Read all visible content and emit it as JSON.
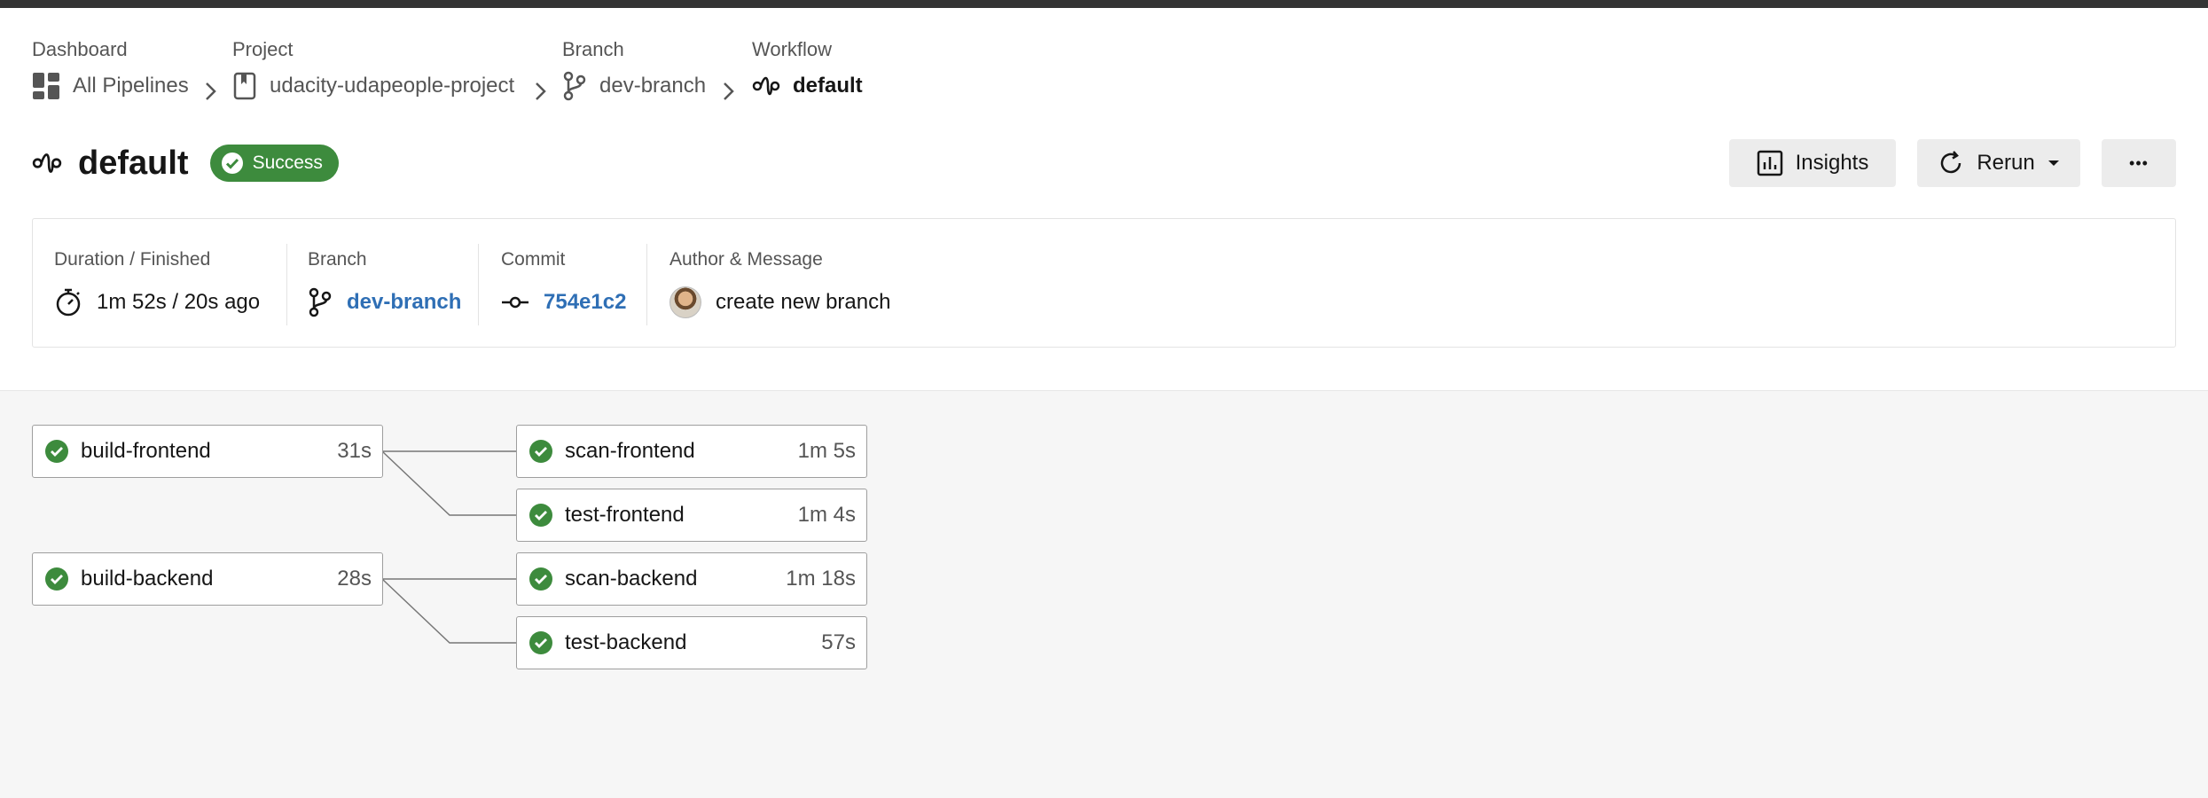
{
  "breadcrumbs": [
    {
      "label": "Dashboard",
      "value": "All Pipelines",
      "icon": "dashboard-grid-icon"
    },
    {
      "label": "Project",
      "value": "udacity-udapeople-project",
      "icon": "bookmark-icon"
    },
    {
      "label": "Branch",
      "value": "dev-branch",
      "icon": "branch-icon"
    },
    {
      "label": "Workflow",
      "value": "default",
      "icon": "workflow-icon"
    }
  ],
  "header": {
    "title": "default",
    "status": "Success",
    "insights_label": "Insights",
    "rerun_label": "Rerun",
    "more_label": "•••"
  },
  "meta": {
    "duration_label": "Duration / Finished",
    "duration_value": "1m 52s / 20s ago",
    "branch_label": "Branch",
    "branch_value": "dev-branch",
    "commit_label": "Commit",
    "commit_value": "754e1c2",
    "author_label": "Author & Message",
    "author_message": "create new branch"
  },
  "jobs": [
    {
      "name": "build-frontend",
      "duration": "31s",
      "status": "success"
    },
    {
      "name": "scan-frontend",
      "duration": "1m 5s",
      "status": "success"
    },
    {
      "name": "test-frontend",
      "duration": "1m 4s",
      "status": "success"
    },
    {
      "name": "build-backend",
      "duration": "28s",
      "status": "success"
    },
    {
      "name": "scan-backend",
      "duration": "1m 18s",
      "status": "success"
    },
    {
      "name": "test-backend",
      "duration": "57s",
      "status": "success"
    }
  ],
  "colors": {
    "success": "#3d8b3d",
    "link": "#2f6fb5"
  }
}
